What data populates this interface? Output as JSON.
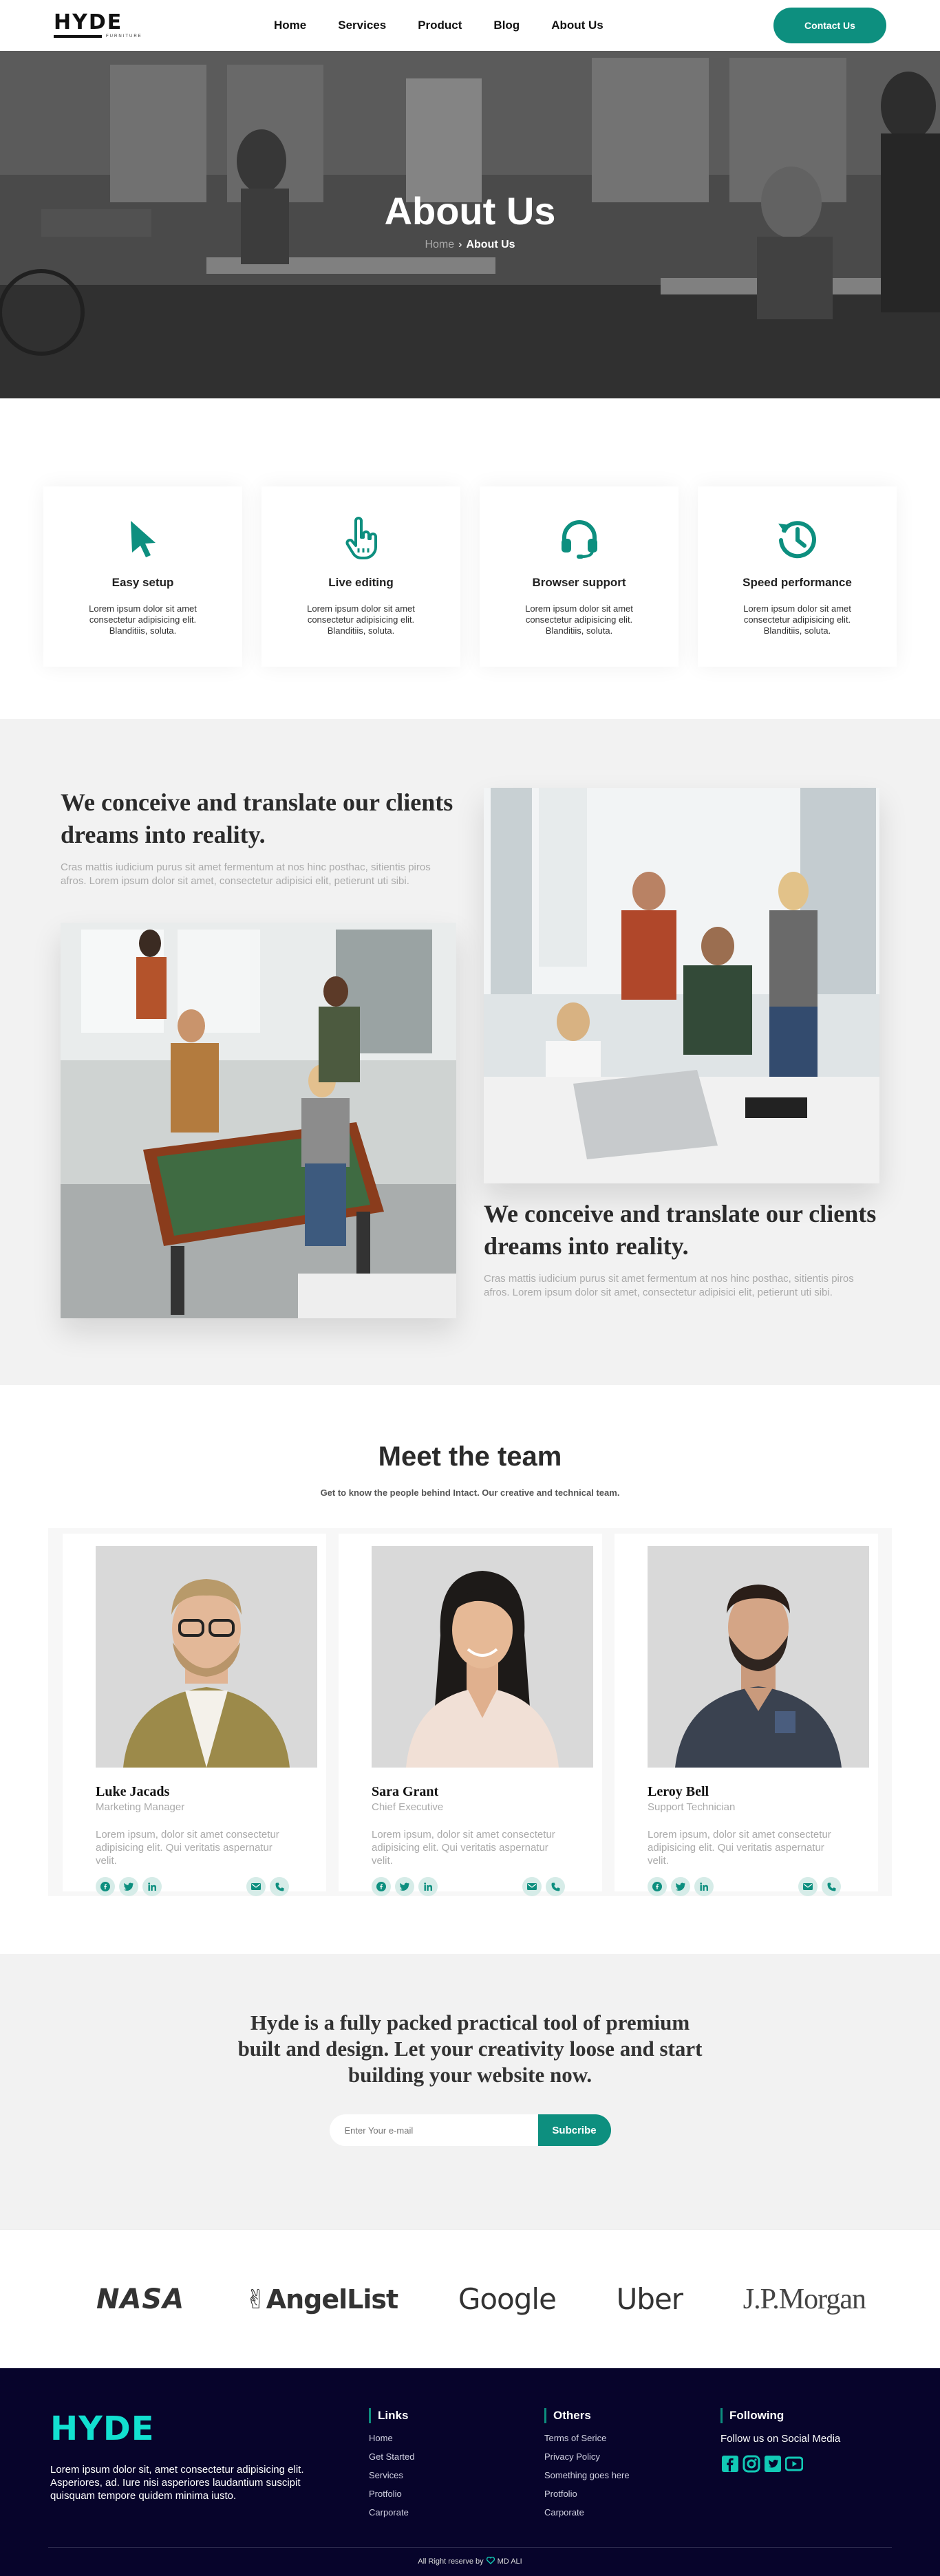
{
  "brand": {
    "name": "HYDE",
    "tagline": "FURNITURE"
  },
  "nav": {
    "items": [
      {
        "label": "Home"
      },
      {
        "label": "Services"
      },
      {
        "label": "Product"
      },
      {
        "label": "Blog"
      },
      {
        "label": "About Us"
      }
    ],
    "contact_label": "Contact Us"
  },
  "hero": {
    "title": "About Us",
    "breadcrumb": {
      "home": "Home",
      "separator": "›",
      "current": "About Us"
    }
  },
  "features": [
    {
      "icon": "cursor-icon",
      "title": "Easy setup",
      "desc": "Lorem ipsum dolor sit amet consectetur adipisicing elit. Blanditiis, soluta."
    },
    {
      "icon": "hand-pointer-icon",
      "title": "Live editing",
      "desc": "Lorem ipsum dolor sit amet consectetur adipisicing elit. Blanditiis, soluta."
    },
    {
      "icon": "headset-icon",
      "title": "Browser support",
      "desc": "Lorem ipsum dolor sit amet consectetur adipisicing elit. Blanditiis, soluta."
    },
    {
      "icon": "history-icon",
      "title": "Speed performance",
      "desc": "Lorem ipsum dolor sit amet consectetur adipisicing elit. Blanditiis, soluta."
    }
  ],
  "about": {
    "block1": {
      "heading": "We conceive and translate our clients dreams into reality.",
      "desc": "Cras mattis iudicium purus sit amet fermentum at nos hinc posthac, sitientis piros afros. Lorem ipsum dolor sit amet, consectetur adipisici elit, petierunt uti sibi."
    },
    "block2": {
      "heading": "We conceive and translate our clients dreams into reality.",
      "desc": "Cras mattis iudicium purus sit amet fermentum at nos hinc posthac, sitientis piros afros. Lorem ipsum dolor sit amet, consectetur adipisici elit, petierunt uti sibi."
    }
  },
  "team": {
    "title": "Meet the team",
    "subtitle": "Get to know the people behind Intact. Our creative and technical team.",
    "members": [
      {
        "name": "Luke Jacads",
        "role": "Marketing Manager",
        "bio": "Lorem ipsum, dolor sit amet consectetur adipisicing elit. Qui veritatis aspernatur velit."
      },
      {
        "name": "Sara Grant",
        "role": "Chief Executive",
        "bio": "Lorem ipsum, dolor sit amet consectetur adipisicing elit. Qui veritatis aspernatur velit."
      },
      {
        "name": "Leroy Bell",
        "role": "Support Technician",
        "bio": "Lorem ipsum, dolor sit amet consectetur adipisicing elit. Qui veritatis aspernatur velit."
      }
    ]
  },
  "newsletter": {
    "text": "Hyde is a fully packed practical tool of premium built and design. Let your creativity loose and start building your website now.",
    "placeholder": "Enter Your e-mail",
    "button": "Subcribe"
  },
  "partners": [
    "NASA",
    "AngelList",
    "Google",
    "Uber",
    "J.P.Morgan"
  ],
  "footer": {
    "logo": "HYDE",
    "about": "Lorem ipsum dolor sit, amet consectetur adipisicing elit. Asperiores, ad. Iure nisi asperiores laudantium suscipit quisquam tempore quidem minima iusto.",
    "links_title": "Links",
    "links": [
      "Home",
      "Get Started",
      "Services",
      "Protfolio",
      "Carporate"
    ],
    "others_title": "Others",
    "others": [
      "Terms of Serice",
      "Privacy Policy",
      "Something goes here",
      "Protfolio",
      "Carporate"
    ],
    "following_title": "Following",
    "follow_text": "Follow us on Social Media",
    "copyright_prefix": "All Right reserve by",
    "copyright_author": "MD ALI"
  },
  "colors": {
    "accent": "#0d8f7f",
    "footer_bg": "#07042b",
    "footer_logo": "#12e0d0"
  }
}
